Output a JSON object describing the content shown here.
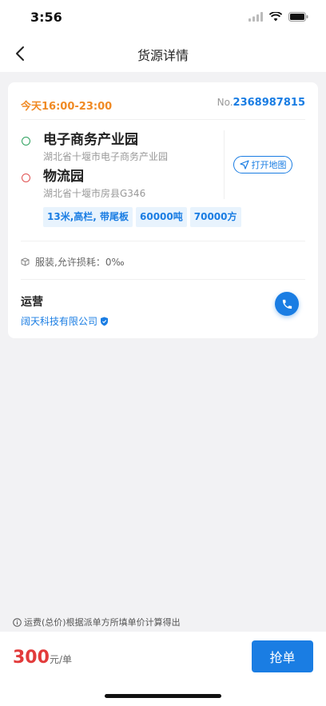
{
  "status_bar": {
    "time": "3:56"
  },
  "nav": {
    "title": "货源详情"
  },
  "order": {
    "time_window": "今天16:00-23:00",
    "no_prefix": "No.",
    "no": "2368987815"
  },
  "route": {
    "origin": {
      "name": "电子商务产业园",
      "address": "湖北省十堰市电子商务产业园"
    },
    "destination": {
      "name": "物流园",
      "address": "湖北省十堰市房县G346"
    },
    "map_button": "打开地图"
  },
  "tags": [
    "13米,高栏, 带尾板",
    "60000吨",
    "70000方"
  ],
  "goods": {
    "text": "服装,允许损耗：0‰"
  },
  "shipper": {
    "label": "运营",
    "company": "阔天科技有限公司"
  },
  "note": {
    "text": "运费(总价)根据派单方所填单价计算得出"
  },
  "footer": {
    "price": "300",
    "unit": "元/单",
    "action": "抢单"
  },
  "colors": {
    "accent": "#1a7de3",
    "price": "#e23b3b",
    "time": "#f08a24"
  }
}
